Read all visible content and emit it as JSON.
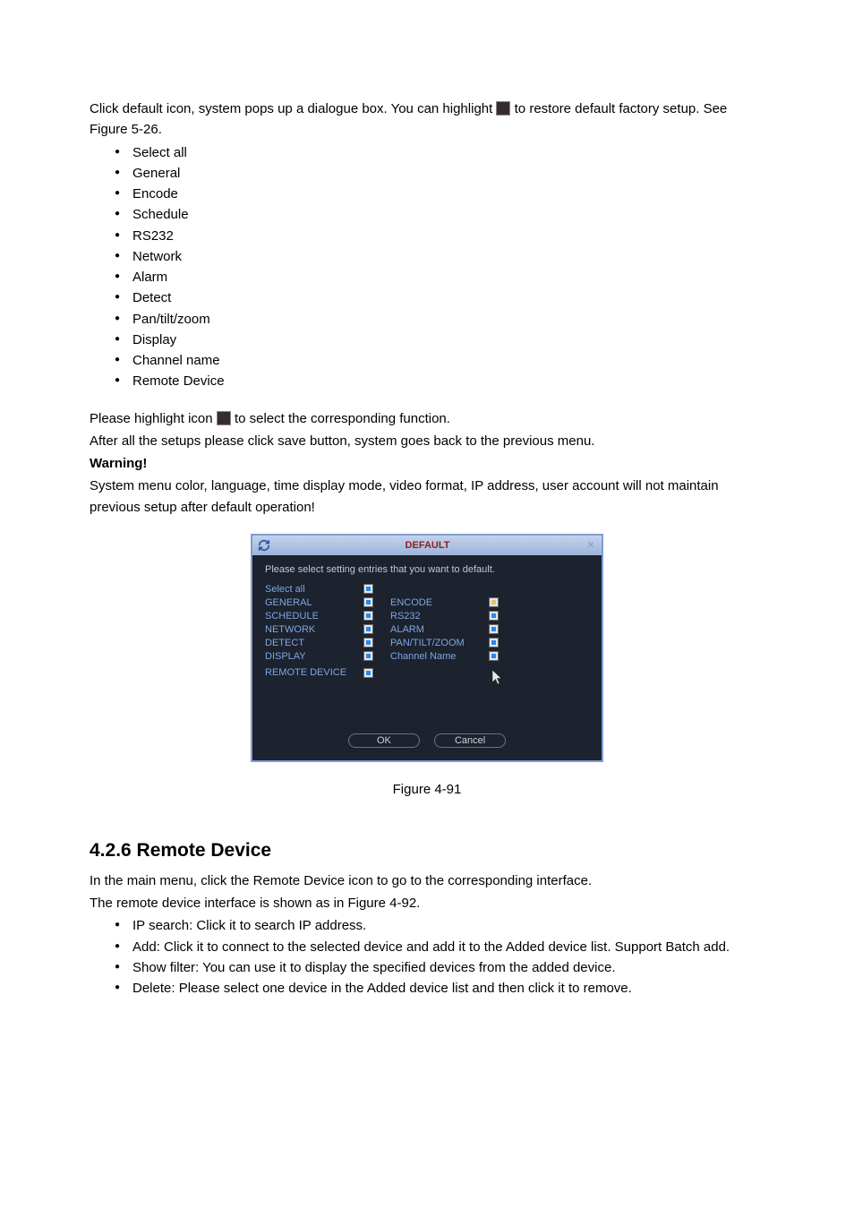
{
  "para1_a": "Click default icon, system pops up a dialogue box. You can highlight ",
  "para1_b": " to restore default factory setup. See Figure 5-26.",
  "bullets1": {
    "b0": "Select all",
    "b1": "General",
    "b2": "Encode",
    "b3": "Schedule",
    "b4": "RS232",
    "b5": "Network",
    "b6": "Alarm",
    "b7": "Detect",
    "b8": "Pan/tilt/zoom",
    "b9": "Display",
    "b10": "Channel name",
    "b11": "Remote Device"
  },
  "para2_a": "Please highlight icon ",
  "para2_b": " to select the corresponding function.",
  "para3": "After all the setups please click save button, system goes back to the previous menu.",
  "warning_label": "Warning!",
  "para4": "System menu color, language, time display mode, video format, IP address, user account will not maintain previous setup after default operation!",
  "dialog": {
    "title": "DEFAULT",
    "instruction": "Please select setting entries that you want to default.",
    "labels": {
      "select_all": "Select all",
      "general": "GENERAL",
      "encode": "ENCODE",
      "schedule": "SCHEDULE",
      "rs232": "RS232",
      "network": "NETWORK",
      "alarm": "ALARM",
      "detect": "DETECT",
      "pantilt": "PAN/TILT/ZOOM",
      "display": "DISPLAY",
      "channel": "Channel Name",
      "remote": "REMOTE DEVICE"
    },
    "buttons": {
      "ok": "OK",
      "cancel": "Cancel"
    }
  },
  "figure_caption": "Figure 4-91",
  "section_heading": "4.2.6 Remote Device",
  "para5": "In the main menu, click the Remote Device icon to go to the corresponding interface.",
  "para6": "The remote device interface is shown as in Figure 4-92.",
  "bullets2": {
    "b0": "IP search: Click it to search IP address.",
    "b1": "Add: Click it to connect to the selected device and add it to the Added device list. Support Batch add.",
    "b2": "Show filter: You can use it to display the specified devices from the added device.",
    "b3": "Delete: Please select one device in the Added device list and then click it to remove."
  }
}
